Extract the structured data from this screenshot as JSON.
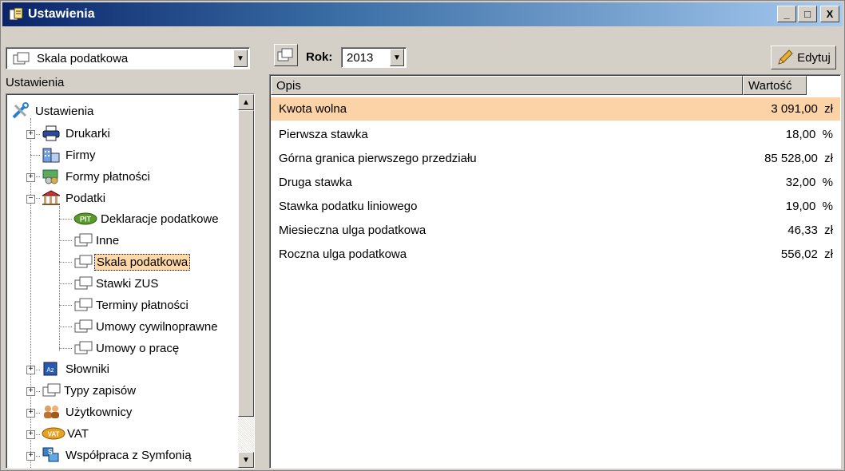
{
  "window": {
    "title": "Ustawienia",
    "controls": {
      "minimize": "_",
      "maximize": "□",
      "close": "X"
    }
  },
  "left_panel": {
    "combo_value": "Skala podatkowa",
    "label": "Ustawienia",
    "tree": {
      "root": "Ustawienia",
      "items": [
        {
          "label": "Drukarki"
        },
        {
          "label": "Firmy"
        },
        {
          "label": "Formy płatności"
        },
        {
          "label": "Podatki"
        },
        {
          "label": "Deklaracje podatkowe"
        },
        {
          "label": "Inne"
        },
        {
          "label": "Skala podatkowa"
        },
        {
          "label": "Stawki ZUS"
        },
        {
          "label": "Terminy płatności"
        },
        {
          "label": "Umowy cywilnoprawne"
        },
        {
          "label": "Umowy o pracę"
        },
        {
          "label": "Słowniki"
        },
        {
          "label": "Typy zapisów"
        },
        {
          "label": "Użytkownicy"
        },
        {
          "label": "VAT"
        },
        {
          "label": "Współpraca z Symfonią"
        }
      ],
      "badges": {
        "pit": "PIT",
        "vat": "VAT",
        "az": "Az"
      }
    }
  },
  "right_panel": {
    "year_label": "Rok:",
    "year_value": "2013",
    "edit_label": "Edytuj",
    "columns": {
      "opis": "Opis",
      "wartosc": "Wartość"
    },
    "rows": [
      {
        "opis": "Kwota wolna",
        "value": "3 091,00",
        "unit": "zł"
      },
      {
        "opis": "Pierwsza stawka",
        "value": "18,00",
        "unit": "%"
      },
      {
        "opis": "Górna granica pierwszego przedziału",
        "value": "85 528,00",
        "unit": "zł"
      },
      {
        "opis": "Druga stawka",
        "value": "32,00",
        "unit": "%"
      },
      {
        "opis": "Stawka podatku liniowego",
        "value": "19,00",
        "unit": "%"
      },
      {
        "opis": "Miesieczna ulga podatkowa",
        "value": "46,33",
        "unit": "zł"
      },
      {
        "opis": "Roczna ulga podatkowa",
        "value": "556,02",
        "unit": "zł"
      }
    ]
  }
}
